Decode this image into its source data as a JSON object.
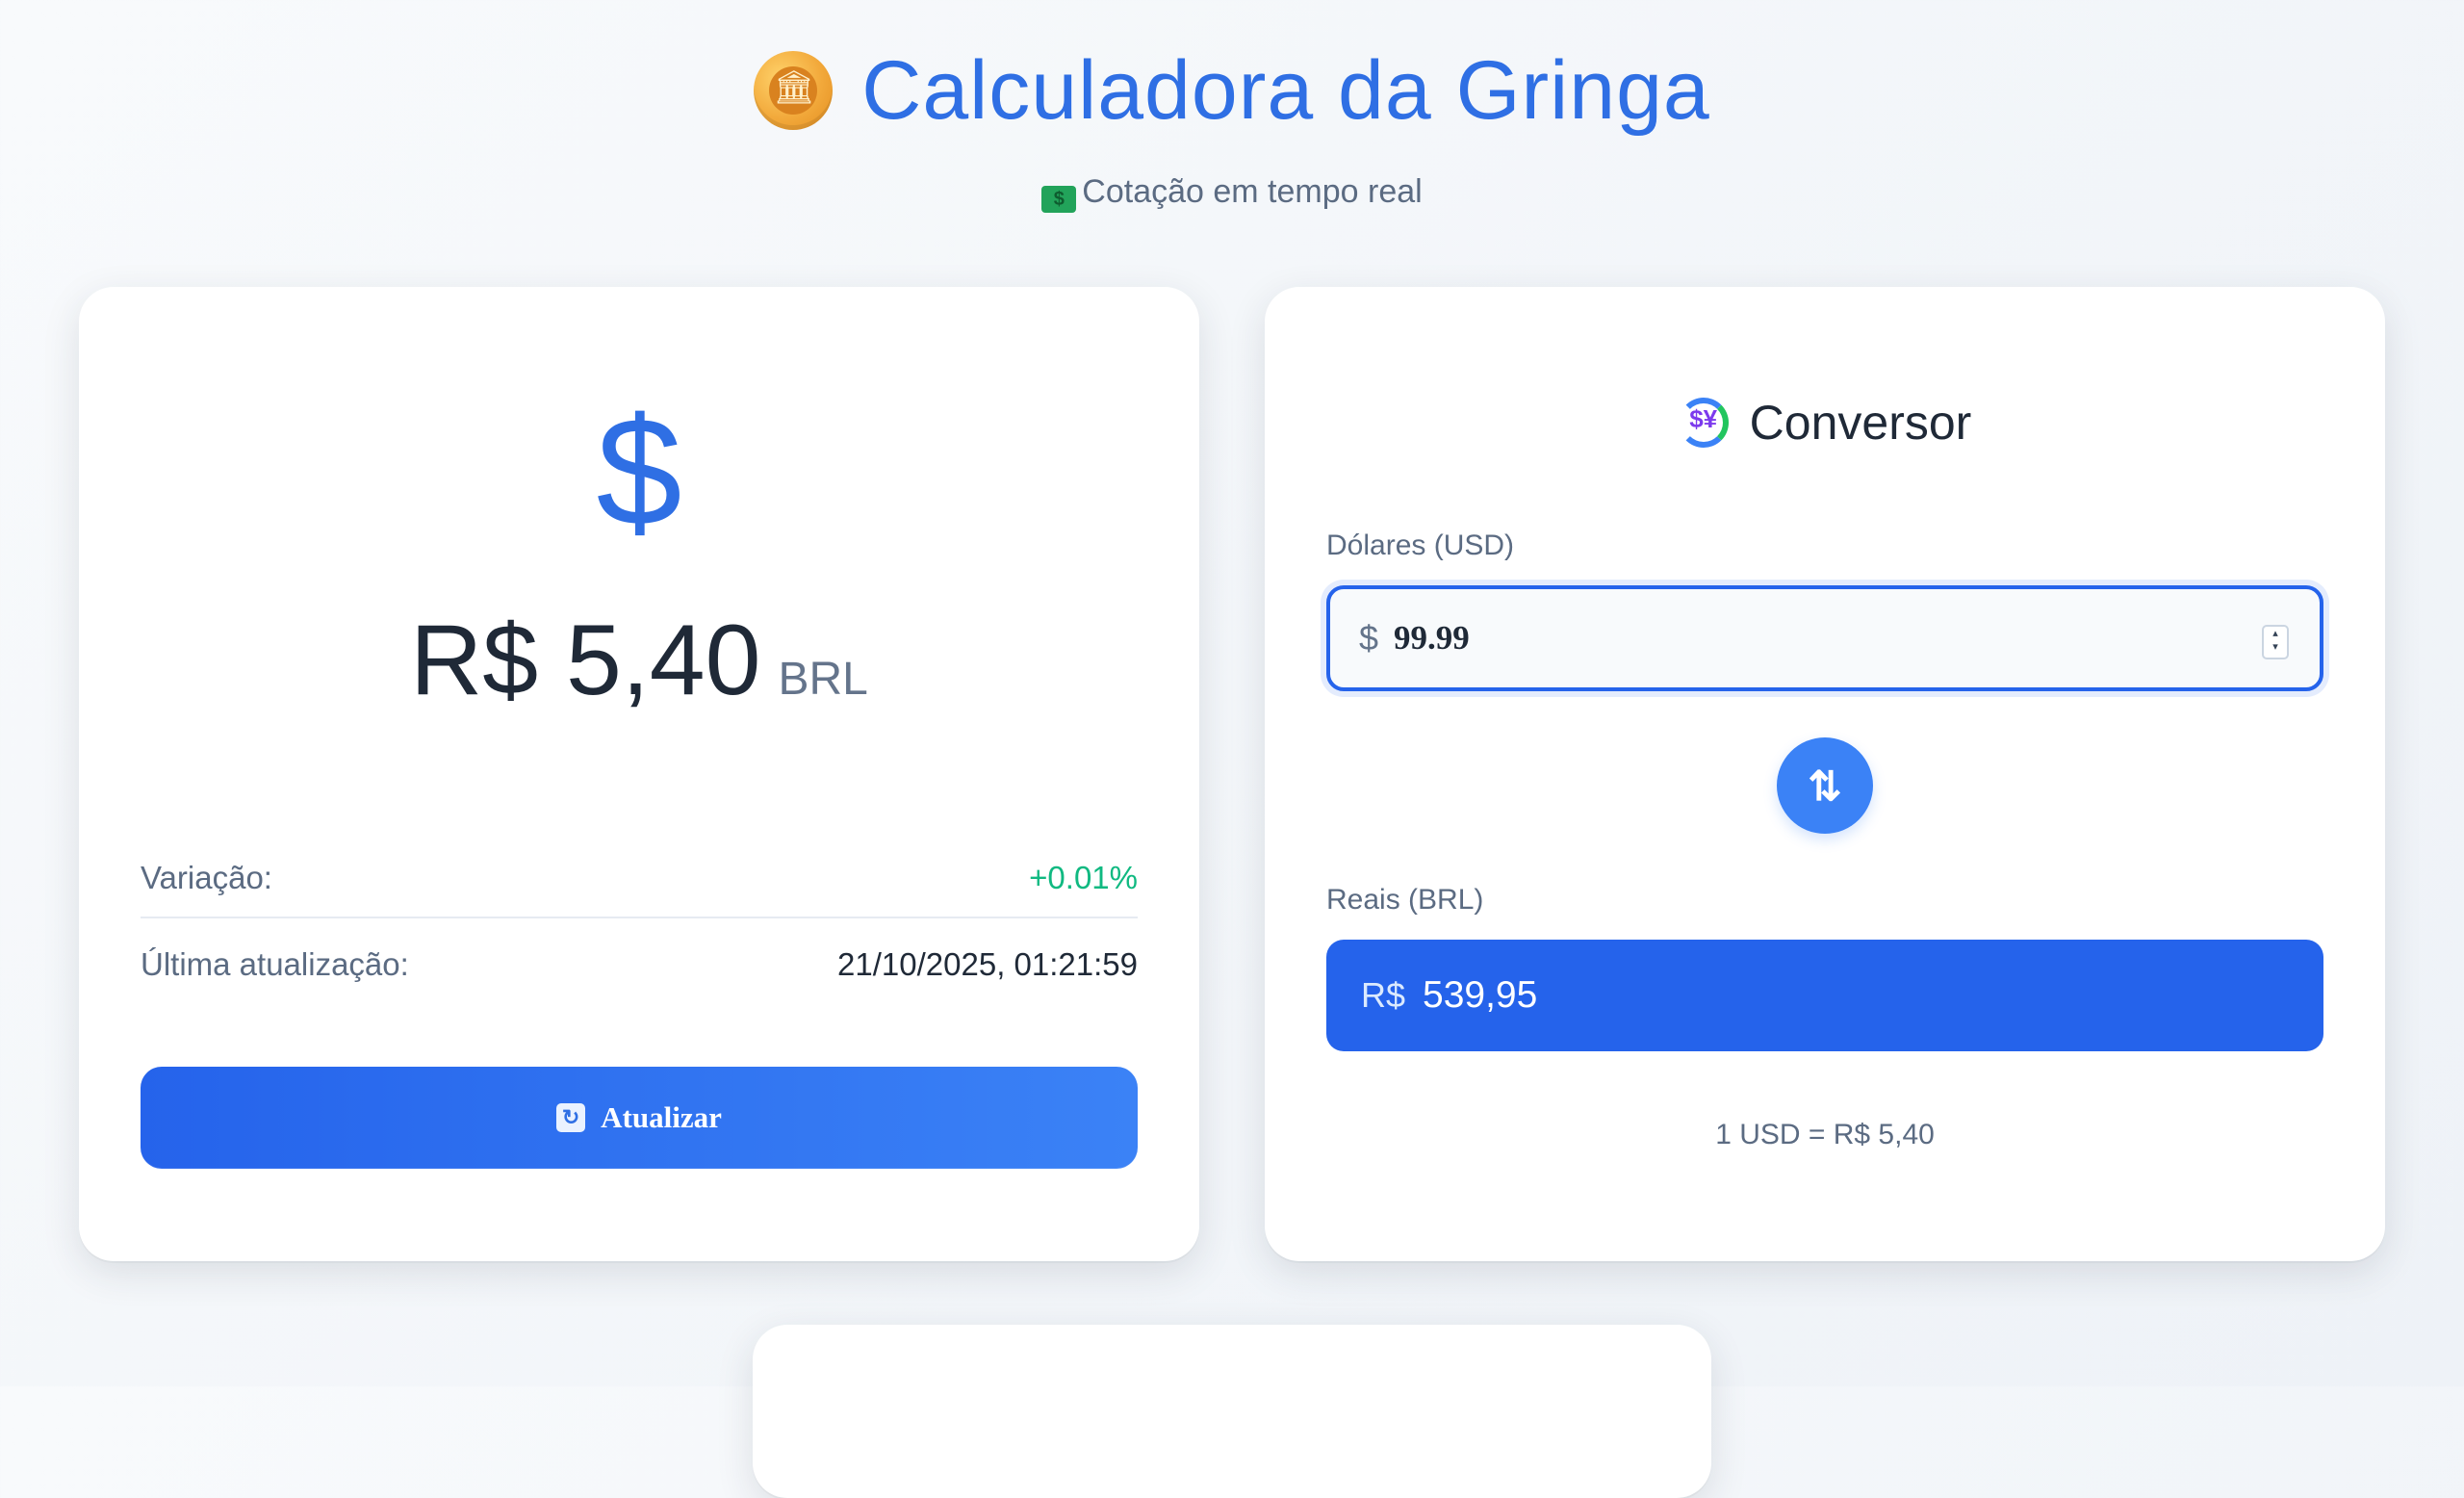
{
  "header": {
    "app_icon": "coin-bank-icon",
    "title": "Calculadora da Gringa",
    "subtitle_icon": "money-icon",
    "subtitle": "Cotação em tempo real"
  },
  "rate_card": {
    "symbol": "$",
    "rate_value": "R$ 5,40",
    "rate_currency": "BRL",
    "variation_label": "Variação:",
    "variation_value": "+0.01%",
    "updated_label": "Última atualização:",
    "updated_value": "21/10/2025, 01:21:59",
    "refresh_icon": "refresh-icon",
    "refresh_label": "Atualizar"
  },
  "converter": {
    "icon": "currency-exchange-icon",
    "title": "Conversor",
    "usd_label": "Dólares (USD)",
    "usd_prefix": "$",
    "usd_value": "99.99",
    "swap_icon": "swap-vertical-icon",
    "brl_label": "Reais (BRL)",
    "brl_prefix": "R$",
    "brl_value": "539,95",
    "rate_note": "1 USD = R$ 5,40"
  },
  "colors": {
    "accent": "#2563eb",
    "accent_light": "#3b82f6",
    "positive": "#10b981",
    "muted": "#5b6b82"
  }
}
